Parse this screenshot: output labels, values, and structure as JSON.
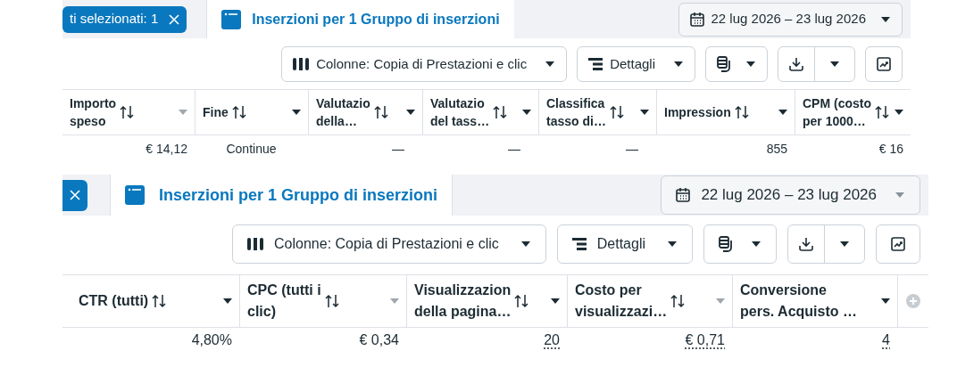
{
  "panels": [
    {
      "selection_chip": {
        "label": "ti selezionati: 1"
      },
      "tab": {
        "label": "Inserzioni per 1 Gruppo di inserzioni",
        "selected": true
      },
      "date_range": {
        "label": "22 lug 2026 – 23 lug 2026",
        "menu_enabled": true
      },
      "toolbar": {
        "columns_button": "Colonne: Copia di Prestazioni e clic",
        "details_button": "Dettagli"
      },
      "columns": [
        {
          "lines": [
            "Importo",
            "speso"
          ],
          "sortable": true,
          "menu_enabled": false
        },
        {
          "lines": [
            "Fine"
          ],
          "sortable": true,
          "menu_enabled": true
        },
        {
          "lines": [
            "Valutazio",
            "della…"
          ],
          "sortable": true,
          "menu_enabled": true
        },
        {
          "lines": [
            "Valutazio",
            "del tass…"
          ],
          "sortable": true,
          "menu_enabled": true
        },
        {
          "lines": [
            "Classifica",
            "tasso di…"
          ],
          "sortable": true,
          "menu_enabled": true
        },
        {
          "lines": [
            "Impression"
          ],
          "sortable": true,
          "menu_enabled": true
        },
        {
          "lines": [
            "CPM (costo",
            "per 1000…"
          ],
          "sortable": true,
          "menu_enabled": true
        }
      ],
      "row": [
        {
          "text": "€ 14,12",
          "kind": "number",
          "underlined": false
        },
        {
          "text": "Continue",
          "kind": "text",
          "underlined": false
        },
        {
          "text": "—",
          "kind": "empty",
          "underlined": false
        },
        {
          "text": "—",
          "kind": "empty",
          "underlined": false
        },
        {
          "text": "—",
          "kind": "empty",
          "underlined": false
        },
        {
          "text": "855",
          "kind": "number",
          "underlined": false
        },
        {
          "text": "€ 16",
          "kind": "number",
          "underlined": false
        }
      ]
    },
    {
      "tab": {
        "label": "Inserzioni per 1 Gruppo di inserzioni",
        "selected": true
      },
      "date_range": {
        "label": "22 lug 2026 – 23 lug 2026",
        "menu_enabled": false
      },
      "toolbar": {
        "columns_button": "Colonne: Copia di Prestazioni e clic",
        "details_button": "Dettagli"
      },
      "columns": [
        {
          "lines": [
            "CTR (tutti)"
          ],
          "sortable": true,
          "menu_enabled": true
        },
        {
          "lines": [
            "CPC (tutti i",
            "clic)"
          ],
          "sortable": true,
          "menu_enabled": false
        },
        {
          "lines": [
            "Visualizzazion",
            "della pagina…"
          ],
          "sortable": true,
          "menu_enabled": true
        },
        {
          "lines": [
            "Costo per",
            "visualizzazi…"
          ],
          "sortable": true,
          "menu_enabled": false
        },
        {
          "lines": [
            "Conversione",
            "pers. Acquisto …"
          ],
          "sortable": false,
          "menu_enabled": true
        }
      ],
      "row": [
        {
          "text": "4,80%",
          "kind": "number",
          "underlined": false
        },
        {
          "text": "€ 0,34",
          "kind": "number",
          "underlined": false
        },
        {
          "text": "20",
          "kind": "number",
          "underlined": true
        },
        {
          "text": "€ 0,71",
          "kind": "number",
          "underlined": true
        },
        {
          "text": "4",
          "kind": "number",
          "underlined": true
        }
      ]
    }
  ]
}
